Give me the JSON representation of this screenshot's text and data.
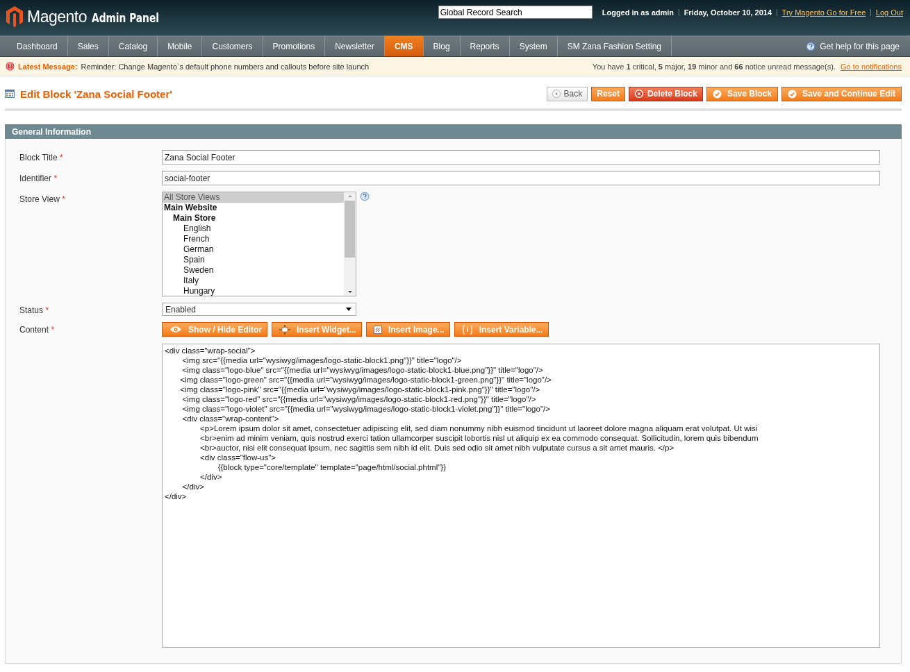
{
  "header": {
    "logo_text": "Magento",
    "logo_subtitle": "Admin Panel",
    "search": {
      "value": "Global Record Search"
    },
    "logged_in": "Logged in as admin",
    "date": "Friday, October 10, 2014",
    "separators": [
      "|",
      "|",
      "|"
    ],
    "links": [
      "Try Magento Go for Free",
      "Log Out"
    ]
  },
  "nav": {
    "items": [
      {
        "label": "Dashboard",
        "selected": false
      },
      {
        "label": "Sales",
        "selected": false
      },
      {
        "label": "Catalog",
        "selected": false
      },
      {
        "label": "Mobile",
        "selected": false
      },
      {
        "label": "Customers",
        "selected": false
      },
      {
        "label": "Promotions",
        "selected": false
      },
      {
        "label": "Newsletter",
        "selected": false
      },
      {
        "label": "CMS",
        "selected": true
      },
      {
        "label": "Blog",
        "selected": false
      },
      {
        "label": "Reports",
        "selected": false
      },
      {
        "label": "System",
        "selected": false
      },
      {
        "label": "SM Zana Fashion Setting",
        "selected": false
      }
    ],
    "help": "Get help for this page"
  },
  "message_bar": {
    "label": "Latest Message:",
    "text": "Reminder: Change Magento`s default phone numbers and callouts before site launch",
    "summary": "You have **1** critical, **5** major, **19** minor and **66** notice unread message(s).",
    "link": "Go to notifications"
  },
  "page": {
    "title": "Edit Block 'Zana Social Footer'",
    "buttons": [
      {
        "label": "Back",
        "kind": "back"
      },
      {
        "label": "Reset",
        "kind": "plain"
      },
      {
        "label": "Delete Block",
        "kind": "delete"
      },
      {
        "label": "Save Block",
        "kind": "save"
      },
      {
        "label": "Save and Continue Edit",
        "kind": "save"
      }
    ]
  },
  "section": {
    "title": "General Information",
    "fields": [
      {
        "label": "Block Title",
        "required_mark": "*",
        "kind": "text",
        "value": "Zana Social Footer"
      },
      {
        "label": "Identifier",
        "required_mark": "*",
        "kind": "text",
        "value": "social-footer"
      },
      {
        "label": "Store View",
        "required_mark": "*",
        "kind": "multiselect",
        "options": [
          {
            "label": "All Store Views",
            "kind": "option",
            "selected": true
          },
          {
            "label": "Main Website",
            "kind": "website",
            "selected": false
          },
          {
            "label": "Main Store",
            "kind": "store",
            "selected": false
          },
          {
            "label": "English",
            "kind": "option",
            "selected": false
          },
          {
            "label": "French",
            "kind": "option",
            "selected": false
          },
          {
            "label": "German",
            "kind": "option",
            "selected": false
          },
          {
            "label": "Spain",
            "kind": "option",
            "selected": false
          },
          {
            "label": "Sweden",
            "kind": "option",
            "selected": false
          },
          {
            "label": "Italy",
            "kind": "option",
            "selected": false
          },
          {
            "label": "Hungary",
            "kind": "option",
            "selected": false
          }
        ]
      },
      {
        "label": "Status",
        "required_mark": "*",
        "kind": "select",
        "value": "Enabled"
      },
      {
        "label": "Content",
        "required_mark": "*",
        "kind": "editor",
        "buttons": [
          {
            "label": "Show / Hide Editor",
            "kind": "eye"
          },
          {
            "label": "Insert Widget...",
            "kind": "widget"
          },
          {
            "label": "Insert Image...",
            "kind": "image"
          },
          {
            "label": "Insert Variable...",
            "kind": "variable"
          }
        ],
        "value": "<div class=\"wrap-social\">\n        <img src=\"{{media url=\"wysiwyg/images/logo-static-block1.png\"}}\" title=\"logo\"/>\n        <img class=\"logo-blue\" src=\"{{media url=\"wysiwyg/images/logo-static-block1-blue.png\"}}\" title=\"logo\"/>\n       <img class=\"logo-green\" src=\"{{media url=\"wysiwyg/images/logo-static-block1-green.png\"}}\" title=\"logo\"/>\n       <img class=\"logo-pink\" src=\"{{media url=\"wysiwyg/images/logo-static-block1-pink.png\"}}\" title=\"logo\"/>\n        <img class=\"logo-red\" src=\"{{media url=\"wysiwyg/images/logo-static-block1-red.png\"}}\" title=\"logo\"/>\n        <img class=\"logo-violet\" src=\"{{media url=\"wysiwyg/images/logo-static-block1-violet.png\"}}\" title=\"logo\"/>\n        <div class=\"wrap-content\">\n                <p>Lorem ipsum dolor sit amet, consectetuer adipiscing elit, sed diam nonummy nibh euismod tincidunt ut laoreet dolore magna aliquam erat volutpat. Ut wisi\n                <br>enim ad minim veniam, quis nostrud exerci tation ullamcorper suscipit lobortis nisl ut aliquip ex ea commodo consequat. Sollicitudin, lorem quis bibendum\n                <br>auctor, nisi elit consequat ipsum, nec sagittis sem nibh id elit. Duis sed odio sit amet nibh vulputate cursus a sit amet mauris. </p>\n                <div class=\"flow-us\">\n                        {{block type=\"core/template\" template=\"page/html/social.phtml\"}}\n                </div>\n        </div>\n</div>"
      }
    ]
  }
}
